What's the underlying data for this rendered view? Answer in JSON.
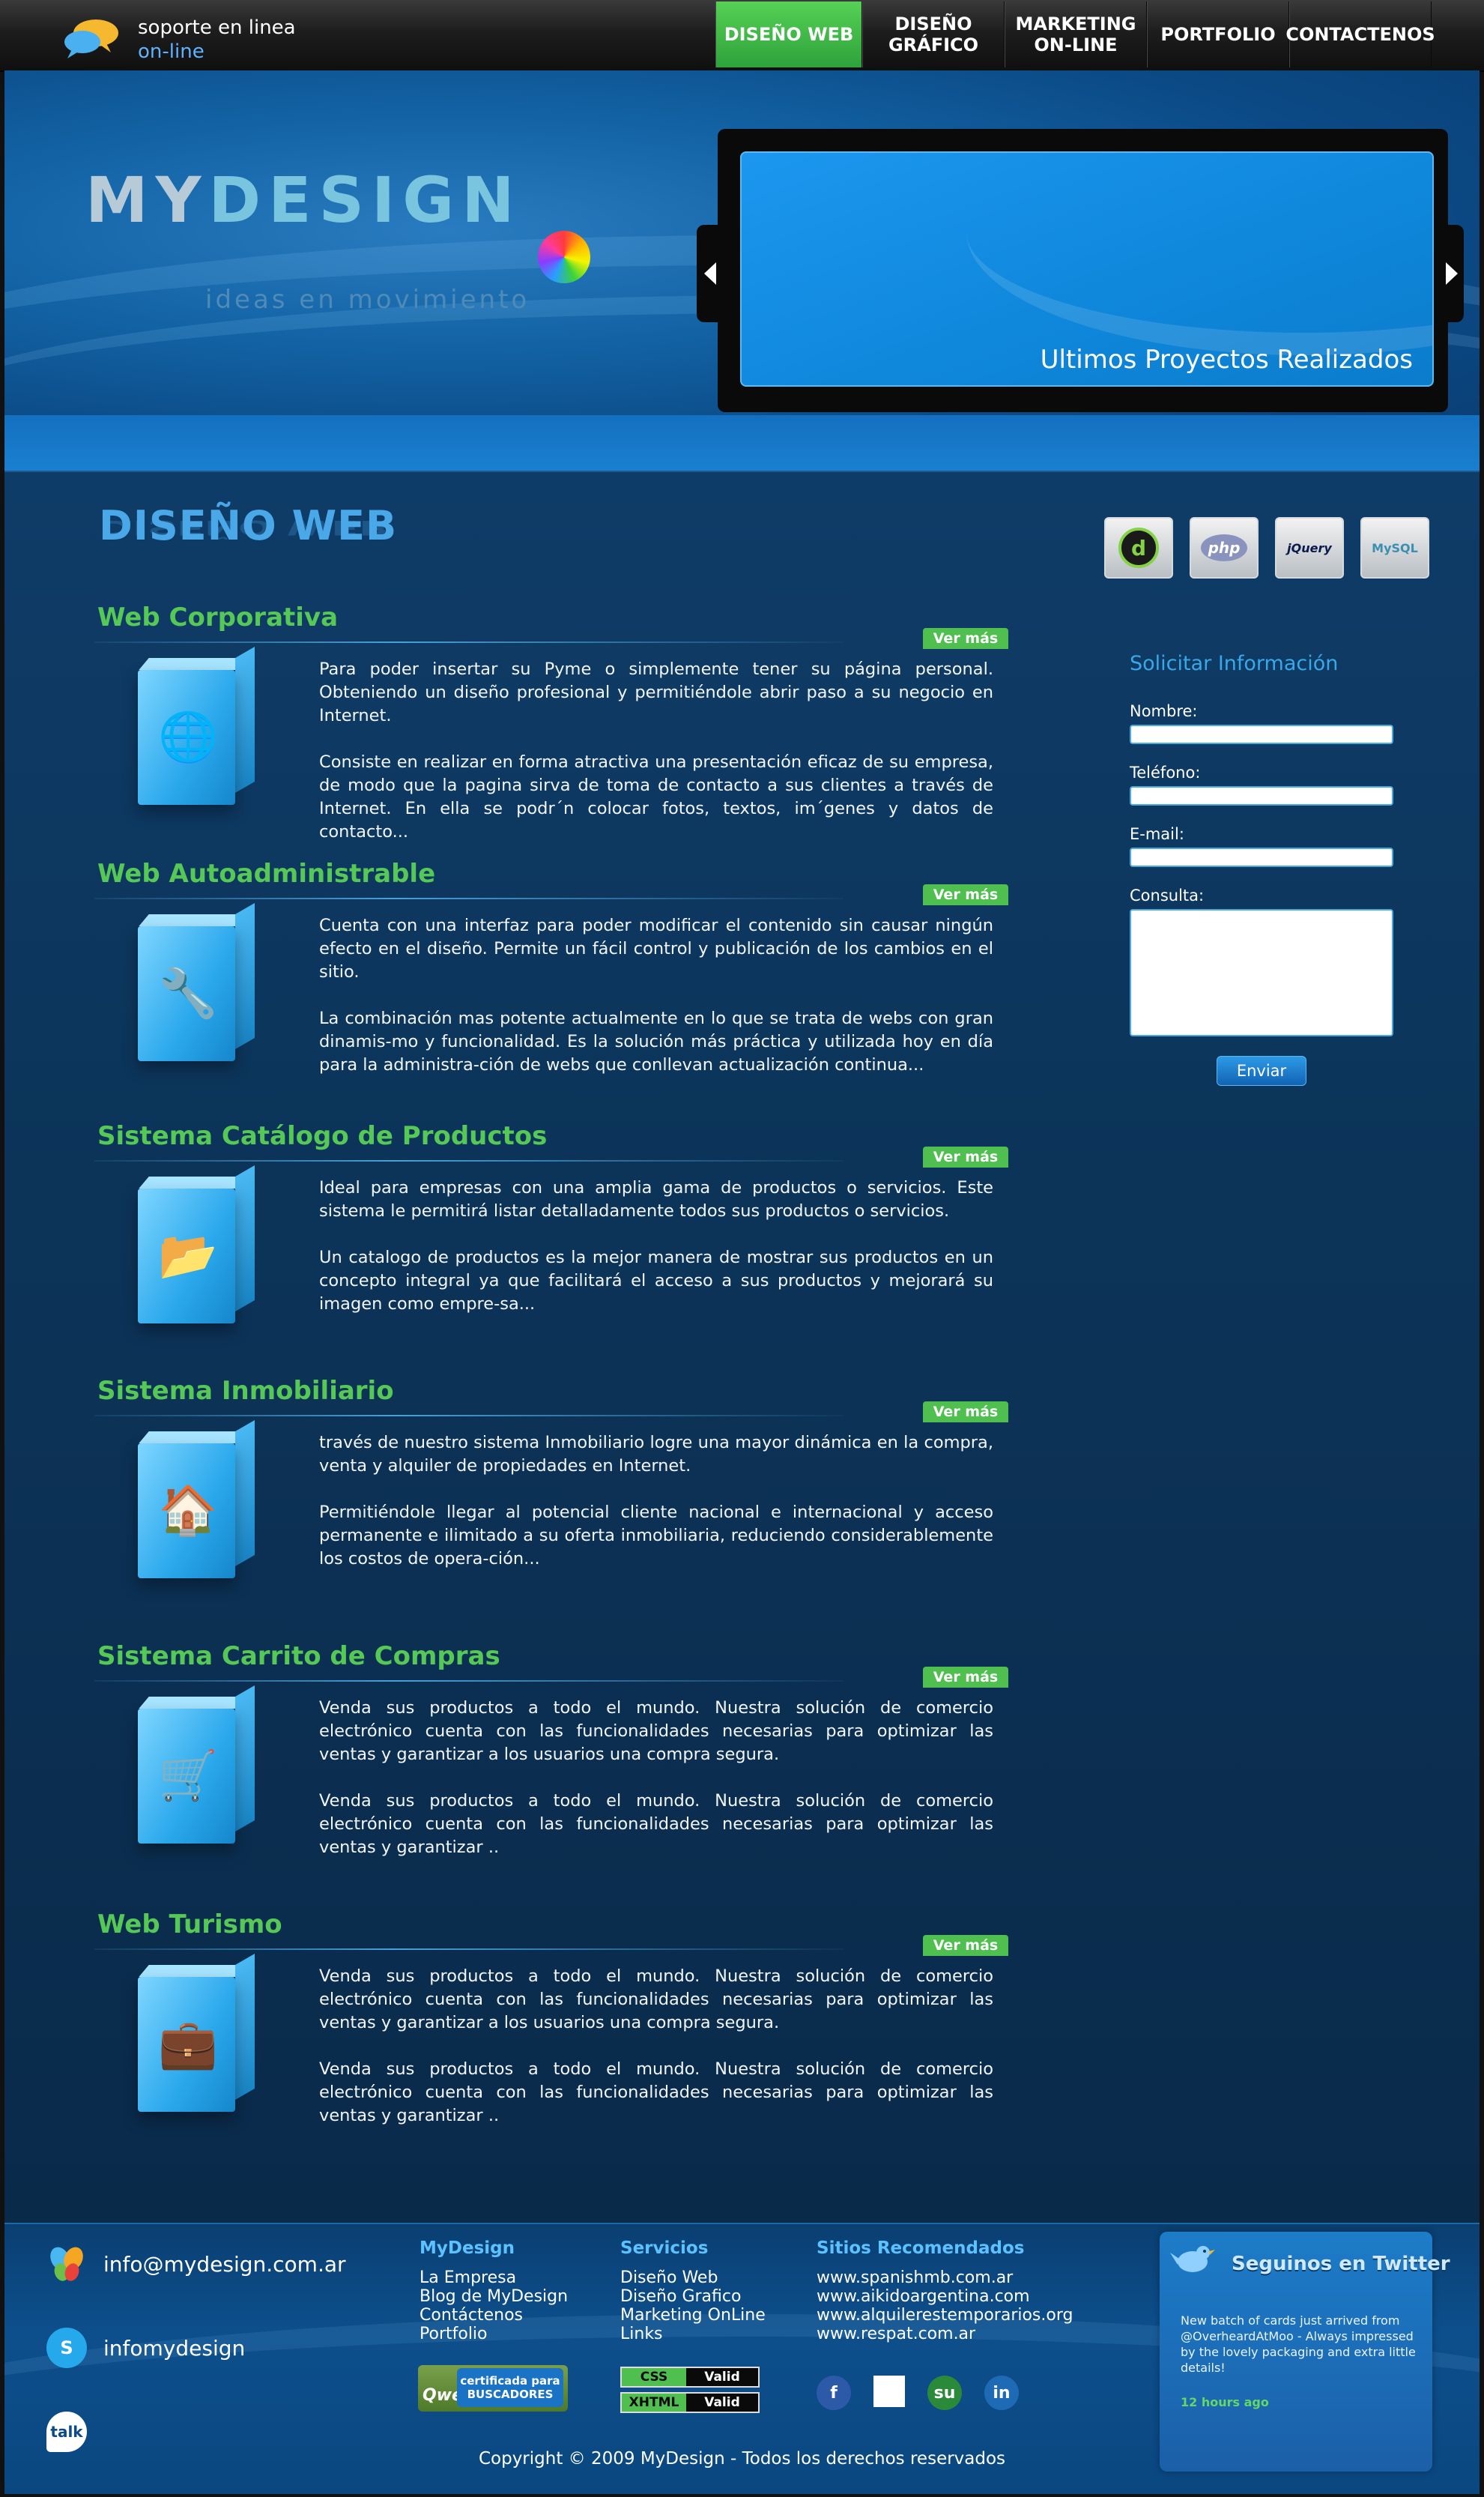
{
  "support": {
    "line1": "soporte en linea",
    "line2": "on-line"
  },
  "nav": [
    {
      "label": "DISEÑO WEB",
      "active": true
    },
    {
      "label": "DISEÑO\nGRÁFICO",
      "active": false
    },
    {
      "label": "MARKETING\nON-LINE",
      "active": false
    },
    {
      "label": "PORTFOLIO",
      "active": false
    },
    {
      "label": "CONTACTENOS",
      "active": false
    }
  ],
  "logo": {
    "my": "MY",
    "design": "DESIGN",
    "tagline": "ideas en movimiento"
  },
  "slider": {
    "caption": "Ultimos Proyectos Realizados"
  },
  "section": {
    "title": "DISEÑO WEB"
  },
  "tech": [
    "Dreamweaver",
    "php",
    "jQuery",
    "MySQL"
  ],
  "services": [
    {
      "title": "Web Corporativa",
      "more": "Ver más",
      "icon": "globe-icon",
      "p1": "Para poder insertar su Pyme o simplemente tener su página personal. Obteniendo un diseño profesional y permitiéndole abrir paso a su negocio en Internet.",
      "p2": "Consiste en realizar en forma atractiva una presentación eficaz de su empresa, de modo que la pagina sirva de toma de contacto a sus clientes a través de Internet. En ella se podr´n colocar fotos, textos, im´genes y datos de contacto..."
    },
    {
      "title": "Web Autoadministrable",
      "more": "Ver más",
      "icon": "tools-icon",
      "p1": "Cuenta con una interfaz para poder modificar el contenido sin causar ningún efecto en el diseño. Permite un fácil control y publicación de los cambios en el sitio.",
      "p2": "La combinación mas potente actualmente en lo que se trata de webs con gran dinamis-mo y funcionalidad. Es la solución más práctica y utilizada hoy en día para la administra-ción de webs que conllevan actualización continua..."
    },
    {
      "title": "Sistema Catálogo de Productos",
      "more": "Ver más",
      "icon": "folder-icon",
      "p1": "Ideal para empresas con una amplia gama de productos o servicios. Este sistema le permitirá listar detalladamente todos sus productos o servicios.",
      "p2": "Un catalogo de productos es la mejor manera de mostrar sus productos en un concepto integral ya que facilitará el acceso a sus productos y mejorará su imagen como empre-sa..."
    },
    {
      "title": "Sistema Inmobiliario",
      "more": "Ver más",
      "icon": "house-icon",
      "p1": " través de nuestro sistema Inmobiliario logre una mayor dinámica en la compra, venta y alquiler de propiedades en Internet.",
      "p2": "Permitiéndole llegar al potencial cliente nacional e internacional y acceso permanente e ilimitado a su oferta inmobiliaria, reduciendo considerablemente los costos de opera-ción..."
    },
    {
      "title": "Sistema Carrito de Compras",
      "more": "Ver más",
      "icon": "cart-icon",
      "p1": "Venda sus productos a todo el mundo. Nuestra solución de comercio electrónico cuenta con las funcionalidades necesarias para optimizar las ventas y garantizar a los usuarios una compra segura.",
      "p2": "Venda sus productos a todo el mundo. Nuestra solución de comercio electrónico cuenta con las funcionalidades necesarias para optimizar las ventas y garantizar .."
    },
    {
      "title": "Web Turismo",
      "more": "Ver más",
      "icon": "suitcase-icon",
      "p1": "Venda sus productos a todo el mundo. Nuestra solución de comercio electrónico cuenta con las funcionalidades necesarias para optimizar las ventas y garantizar a los usuarios una compra segura.",
      "p2": "Venda sus productos a todo el mundo. Nuestra solución de comercio electrónico cuenta con las funcionalidades necesarias para optimizar las ventas y garantizar .."
    }
  ],
  "form": {
    "title": "Solicitar Información",
    "name_label": "Nombre:",
    "phone_label": "Teléfono:",
    "email_label": "E-mail:",
    "query_label": "Consulta:",
    "submit": "Enviar"
  },
  "footer": {
    "email": "info@mydesign.com.ar",
    "skype": "infomydesign",
    "talk_label": "talk",
    "col1": {
      "heading": "MyDesign",
      "items": [
        "La Empresa",
        "Blog de MyDesign",
        "Contáctenos",
        "Portfolio"
      ]
    },
    "col2": {
      "heading": "Servicios",
      "items": [
        "Diseño Web",
        "Diseño Grafico",
        "Marketing OnLine",
        "Links"
      ]
    },
    "col3": {
      "heading": "Sitios Recomendados",
      "items": [
        "www.spanishmb.com.ar",
        "www.aikidoargentina.com",
        "www.alquilerestemporarios.org",
        "www.respat.com.ar"
      ]
    },
    "qweb": {
      "brand": "Qweb",
      "cert": "certificada para BUSCADORES"
    },
    "valid": [
      {
        "k": "CSS",
        "v": "Valid"
      },
      {
        "k": "XHTML",
        "v": "Valid"
      }
    ],
    "twitter": {
      "title": "Seguinos en Twitter",
      "message": "New batch of cards just arrived from @OverheardAtMoo - Always impressed by the lovely packaging and extra little details!",
      "time": "12 hours ago"
    },
    "copyright": "Copyright © 2009 MyDesign - Todos los derechos reservados"
  }
}
